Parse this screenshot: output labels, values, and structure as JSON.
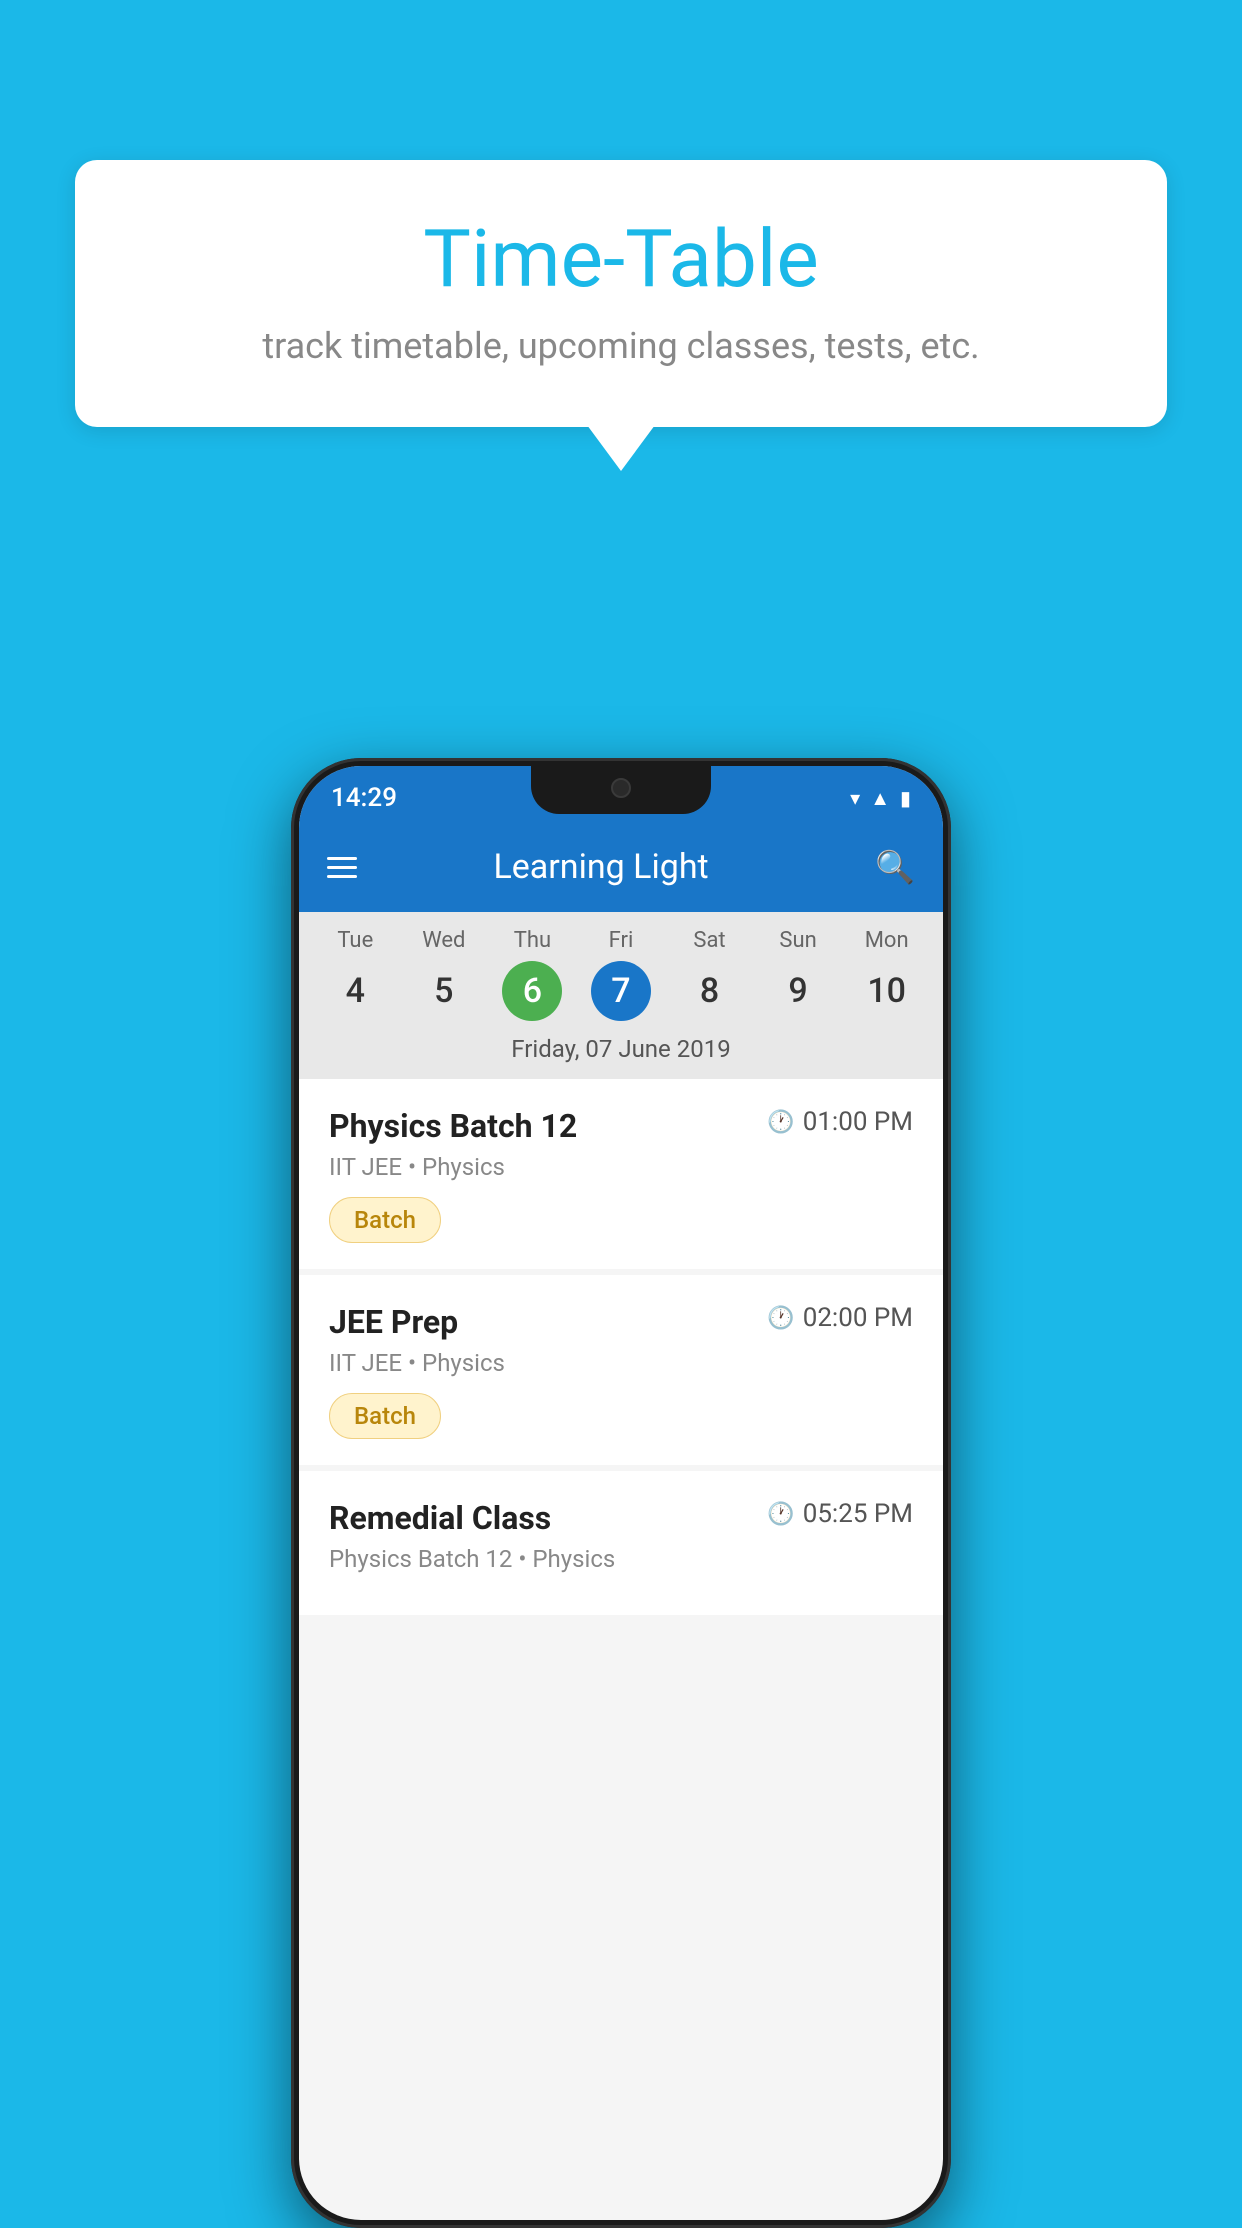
{
  "background_color": "#1BB8E8",
  "bubble": {
    "title": "Time-Table",
    "subtitle": "track timetable, upcoming classes, tests, etc."
  },
  "phone": {
    "status_bar": {
      "time": "14:29"
    },
    "app_bar": {
      "title": "Learning Light"
    },
    "calendar": {
      "days": [
        {
          "name": "Tue",
          "number": "4",
          "state": "normal"
        },
        {
          "name": "Wed",
          "number": "5",
          "state": "normal"
        },
        {
          "name": "Thu",
          "number": "6",
          "state": "today"
        },
        {
          "name": "Fri",
          "number": "7",
          "state": "selected"
        },
        {
          "name": "Sat",
          "number": "8",
          "state": "normal"
        },
        {
          "name": "Sun",
          "number": "9",
          "state": "normal"
        },
        {
          "name": "Mon",
          "number": "10",
          "state": "normal"
        }
      ],
      "selected_date_label": "Friday, 07 June 2019"
    },
    "schedule": [
      {
        "name": "Physics Batch 12",
        "time": "01:00 PM",
        "category": "IIT JEE • Physics",
        "badge": "Batch"
      },
      {
        "name": "JEE Prep",
        "time": "02:00 PM",
        "category": "IIT JEE • Physics",
        "badge": "Batch"
      },
      {
        "name": "Remedial Class",
        "time": "05:25 PM",
        "category": "Physics Batch 12 • Physics",
        "badge": ""
      }
    ]
  }
}
